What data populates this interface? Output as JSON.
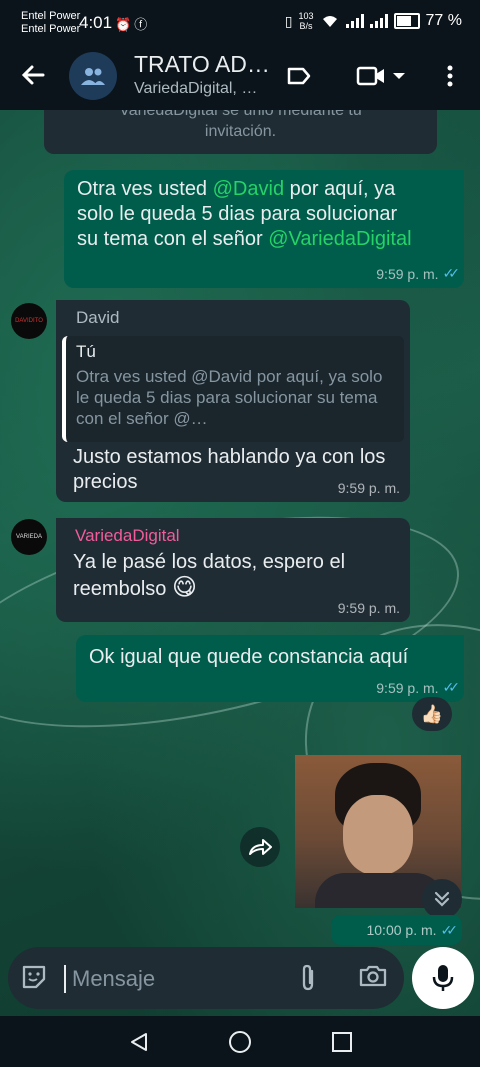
{
  "status_bar": {
    "carrier_1": "Entel Power",
    "carrier_2": "Entel Power",
    "time": "4:01",
    "speed_value": "103",
    "speed_unit": "B/s",
    "battery_percent": "77 %",
    "battery_level": 0.77
  },
  "header": {
    "title": "TRATO AD…",
    "subtitle": "VariedaDigital, …"
  },
  "system_message": {
    "line1": "VariedaDigital se unió mediante tu",
    "line2": "invitación."
  },
  "messages": [
    {
      "type": "outgoing",
      "parts": [
        "Otra ves usted ",
        "@David",
        " por aquí, ya solo le queda 5 dias para solucionar su tema con el señor ",
        "@VariedaDigital"
      ],
      "time": "9:59 p. m.",
      "status": "read"
    },
    {
      "type": "incoming",
      "sender": "David",
      "avatar_text": "DAVIDITO",
      "quote_author": "Tú",
      "quote_text": "Otra ves usted @David por aquí, ya solo le queda 5 dias para solucionar su tema con el señor @…",
      "text": "Justo estamos hablando ya con los precios",
      "time": "9:59 p. m."
    },
    {
      "type": "incoming",
      "sender": "VariedaDigital",
      "avatar_text": "VARIEDA",
      "text": "Ya le pasé los datos, espero el reembolso",
      "emoji": "😋",
      "time": "9:59 p. m."
    },
    {
      "type": "outgoing",
      "text": "Ok igual que quede constancia aquí",
      "time": "9:59 p. m.",
      "status": "read",
      "reaction": "👍🏻"
    },
    {
      "type": "outgoing-image",
      "time": "10:00 p. m.",
      "status": "read"
    }
  ],
  "composer": {
    "placeholder": "Mensaje"
  },
  "colors": {
    "outgoing_bubble": "#005c4b",
    "incoming_bubble": "#1f2c34",
    "read_ticks": "#53bdeb",
    "mention_green": "#25d366",
    "sender_david": "#aebac1",
    "sender_varieda": "#f15c9b"
  }
}
